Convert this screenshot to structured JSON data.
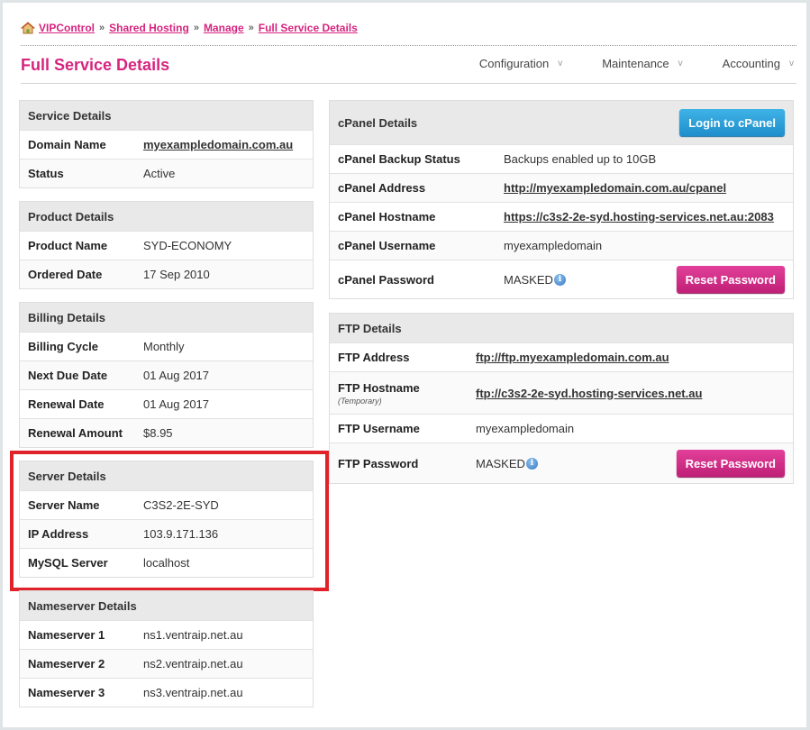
{
  "breadcrumb": {
    "items": [
      "VIPControl",
      "Shared Hosting",
      "Manage",
      "Full Service Details"
    ],
    "separator": "»"
  },
  "page_title": "Full Service Details",
  "top_nav": [
    {
      "label": "Configuration",
      "chevron": "v"
    },
    {
      "label": "Maintenance",
      "chevron": "v"
    },
    {
      "label": "Accounting",
      "chevron": "v"
    }
  ],
  "service_details": {
    "title": "Service Details",
    "rows": [
      {
        "label": "Domain Name",
        "value": "myexampledomain.com.au"
      },
      {
        "label": "Status",
        "value": "Active"
      }
    ]
  },
  "product_details": {
    "title": "Product Details",
    "rows": [
      {
        "label": "Product Name",
        "value": "SYD-ECONOMY"
      },
      {
        "label": "Ordered Date",
        "value": "17 Sep 2010"
      }
    ]
  },
  "billing_details": {
    "title": "Billing Details",
    "rows": [
      {
        "label": "Billing Cycle",
        "value": "Monthly"
      },
      {
        "label": "Next Due Date",
        "value": "01 Aug 2017"
      },
      {
        "label": "Renewal Date",
        "value": "01 Aug 2017"
      },
      {
        "label": "Renewal Amount",
        "value": "$8.95"
      }
    ]
  },
  "server_details": {
    "title": "Server Details",
    "rows": [
      {
        "label": "Server Name",
        "value": "C3S2-2E-SYD"
      },
      {
        "label": "IP Address",
        "value": "103.9.171.136"
      },
      {
        "label": "MySQL Server",
        "value": "localhost"
      }
    ]
  },
  "nameserver_details": {
    "title": "Nameserver Details",
    "rows": [
      {
        "label": "Nameserver 1",
        "value": "ns1.ventraip.net.au"
      },
      {
        "label": "Nameserver 2",
        "value": "ns2.ventraip.net.au"
      },
      {
        "label": "Nameserver 3",
        "value": "ns3.ventraip.net.au"
      }
    ]
  },
  "cpanel_details": {
    "title": "cPanel Details",
    "login_button": "Login to cPanel",
    "rows": [
      {
        "label": "cPanel Backup Status",
        "value": "Backups enabled up to 10GB"
      },
      {
        "label": "cPanel Address",
        "value": "http://myexampledomain.com.au/cpanel"
      },
      {
        "label": "cPanel Hostname",
        "value": "https://c3s2-2e-syd.hosting-services.net.au:2083"
      },
      {
        "label": "cPanel Username",
        "value": "myexampledomain"
      },
      {
        "label": "cPanel Password",
        "value": "MASKED"
      }
    ],
    "reset_button": "Reset Password"
  },
  "ftp_details": {
    "title": "FTP Details",
    "rows": [
      {
        "label": "FTP Address",
        "value": "ftp://ftp.myexampledomain.com.au"
      },
      {
        "label": "FTP Hostname",
        "note": "(Temporary)",
        "value": "ftp://c3s2-2e-syd.hosting-services.net.au"
      },
      {
        "label": "FTP Username",
        "value": "myexampledomain"
      },
      {
        "label": "FTP Password",
        "value": "MASKED"
      }
    ],
    "reset_button": "Reset Password"
  },
  "icons": {
    "home": "home-icon",
    "info": "info-icon",
    "info_glyph": "i"
  },
  "colors": {
    "brand_pink": "#d6247f",
    "button_blue": "#2a9fd8",
    "highlight_red": "#e0232b"
  }
}
